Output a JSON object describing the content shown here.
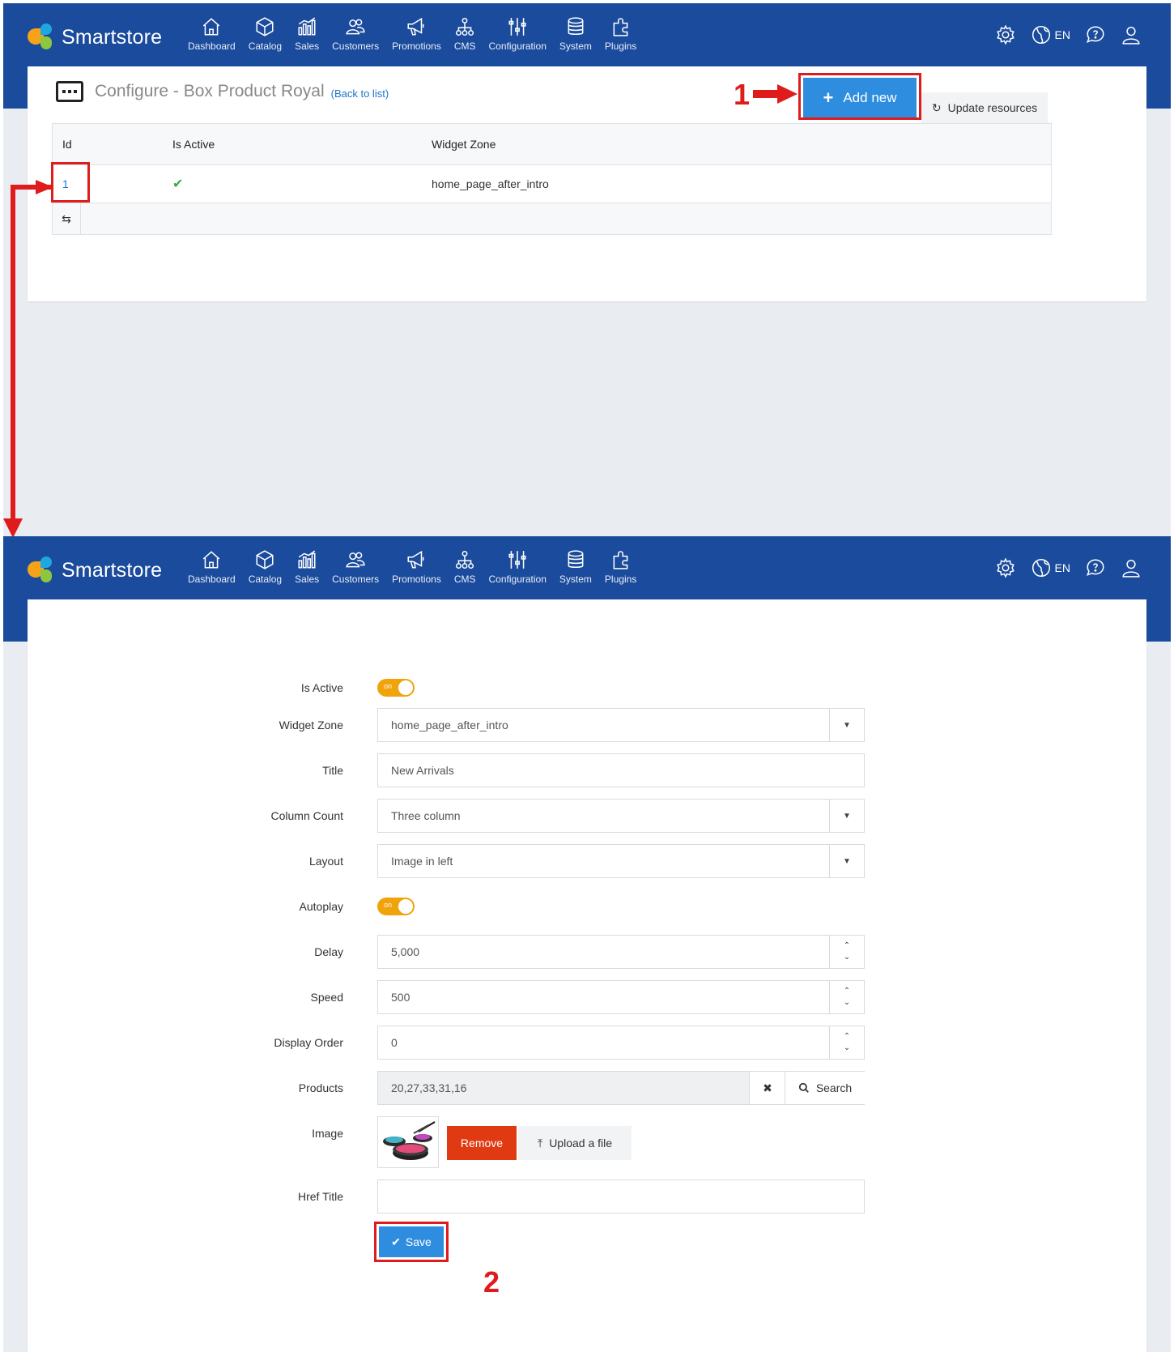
{
  "brand": {
    "name": "Smartstore"
  },
  "nav": {
    "items": [
      {
        "label": "Dashboard",
        "icon": "home-icon"
      },
      {
        "label": "Catalog",
        "icon": "cube-icon"
      },
      {
        "label": "Sales",
        "icon": "chart-icon"
      },
      {
        "label": "Customers",
        "icon": "users-icon"
      },
      {
        "label": "Promotions",
        "icon": "megaphone-icon"
      },
      {
        "label": "CMS",
        "icon": "sitemap-icon"
      },
      {
        "label": "Configuration",
        "icon": "sliders-icon"
      },
      {
        "label": "System",
        "icon": "database-icon"
      },
      {
        "label": "Plugins",
        "icon": "puzzle-icon"
      }
    ],
    "language": "EN"
  },
  "list_page": {
    "title": "Configure - Box Product Royal",
    "back_link": "(Back to list)",
    "add_button": "Add new",
    "update_button": "Update resources",
    "columns": [
      "Id",
      "Is Active",
      "Widget Zone"
    ],
    "rows": [
      {
        "id": "1",
        "active": true,
        "zone": "home_page_after_intro"
      }
    ],
    "annotation": "1"
  },
  "form": {
    "is_active": {
      "label": "Is Active",
      "toggle": "on"
    },
    "widget_zone": {
      "label": "Widget Zone",
      "value": "home_page_after_intro"
    },
    "title": {
      "label": "Title",
      "value": "New Arrivals"
    },
    "column_count": {
      "label": "Column Count",
      "value": "Three column"
    },
    "layout": {
      "label": "Layout",
      "value": "Image in left"
    },
    "autoplay": {
      "label": "Autoplay",
      "toggle": "on"
    },
    "delay": {
      "label": "Delay",
      "value": "5,000"
    },
    "speed": {
      "label": "Speed",
      "value": "500"
    },
    "display_order": {
      "label": "Display Order",
      "value": "0"
    },
    "products": {
      "label": "Products",
      "value": "20,27,33,31,16",
      "search_button": "Search"
    },
    "image": {
      "label": "Image",
      "remove_button": "Remove",
      "upload_button": "Upload a file"
    },
    "href_title": {
      "label": "Href Title",
      "value": ""
    },
    "save_button": "Save",
    "annotation": "2"
  },
  "colors": {
    "navbar": "#1b4b9c",
    "primary": "#2f8de0",
    "toggle": "#f0a30a",
    "danger": "#e03a12",
    "annotation": "#e01b1b"
  }
}
